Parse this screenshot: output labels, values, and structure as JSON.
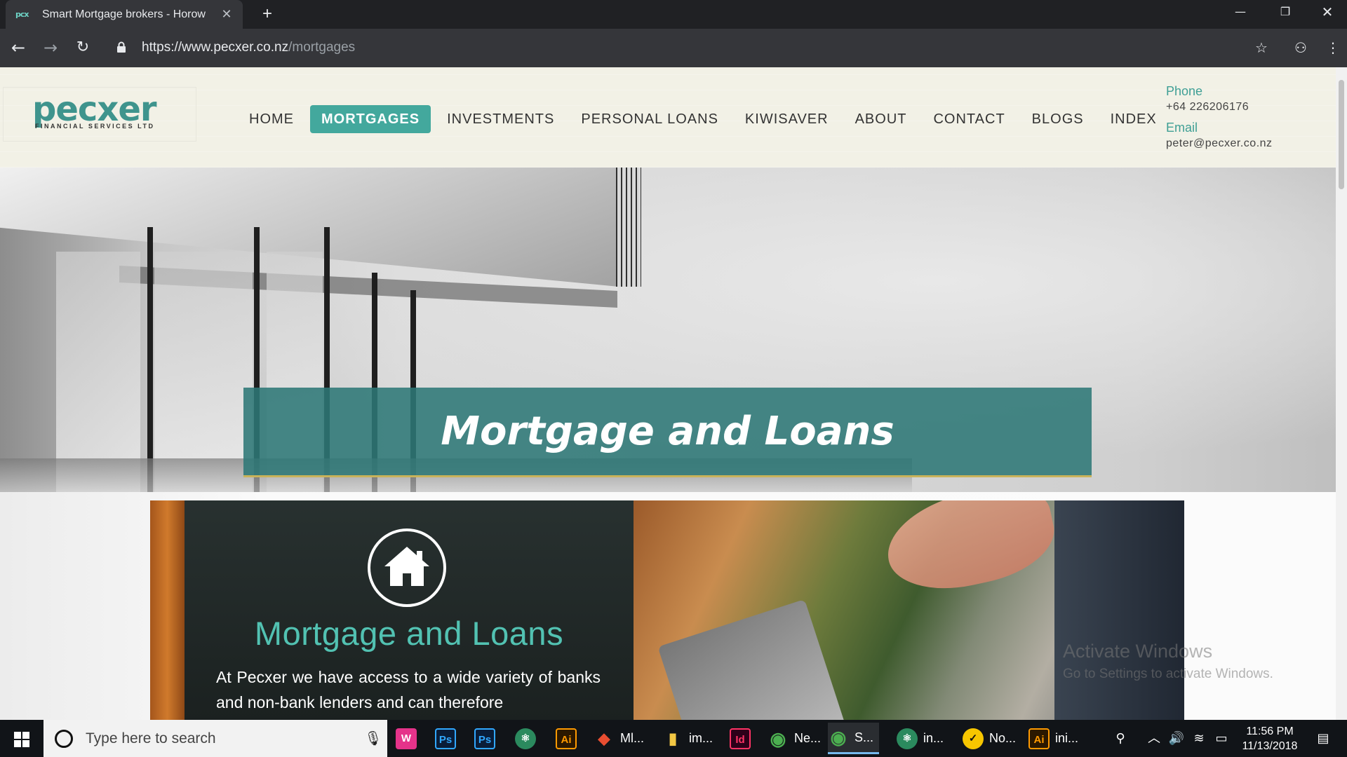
{
  "browser": {
    "tab_title": "Smart Mortgage brokers - Horow",
    "tab_favicon": "pcx",
    "new_tab_symbol": "+",
    "url_host": "https://www.pecxer.co.nz",
    "url_path": "/mortgages"
  },
  "site": {
    "logo_text": "pecxer",
    "logo_subtext": "FINANCIAL SERVICES LTD",
    "nav": [
      {
        "label": "HOME"
      },
      {
        "label": "MORTGAGES",
        "active": true
      },
      {
        "label": "INVESTMENTS"
      },
      {
        "label": "PERSONAL LOANS"
      },
      {
        "label": "KIWISAVER"
      },
      {
        "label": "ABOUT"
      },
      {
        "label": "CONTACT"
      },
      {
        "label": "BLOGS"
      },
      {
        "label": "INDEX"
      }
    ],
    "contact": {
      "phone_label": "Phone",
      "phone": "+64 226206176",
      "email_label": "Email",
      "email": "peter@pecxer.co.nz"
    },
    "hero_title": "Mortgage and Loans",
    "section": {
      "title": "Mortgage and Loans",
      "text": "At Pecxer we have access to a wide variety of banks and non-bank lenders and can therefore"
    },
    "colors": {
      "accent": "#43a89d",
      "banner": "#2e7876",
      "panel_title": "#52c2b2"
    }
  },
  "watermark": {
    "line1": "Activate Windows",
    "line2": "Go to Settings to activate Windows."
  },
  "taskbar": {
    "search_placeholder": "Type here to search",
    "apps": [
      {
        "icon": "webstorm-icon",
        "glyph": "W",
        "label": ""
      },
      {
        "icon": "photoshop-icon",
        "glyph": "Ps",
        "label": ""
      },
      {
        "icon": "photoshop-icon-2",
        "glyph": "Ps",
        "label": ""
      },
      {
        "icon": "atom-icon",
        "glyph": "⚛",
        "label": ""
      },
      {
        "icon": "illustrator-icon",
        "glyph": "Ai",
        "label": ""
      },
      {
        "icon": "git-icon",
        "glyph": "◆",
        "label": "Ml..."
      },
      {
        "icon": "folder-icon",
        "glyph": "▮",
        "label": "im..."
      },
      {
        "icon": "indesign-icon",
        "glyph": "Id",
        "label": ""
      },
      {
        "icon": "chrome-icon",
        "glyph": "◉",
        "label": "Ne..."
      },
      {
        "icon": "chrome-icon-2",
        "glyph": "◉",
        "label": "S..."
      },
      {
        "icon": "atom-icon-2",
        "glyph": "⚛",
        "label": "in..."
      },
      {
        "icon": "norton-icon",
        "glyph": "✓",
        "label": "No..."
      },
      {
        "icon": "illustrator-icon-2",
        "glyph": "Ai",
        "label": "ini..."
      }
    ],
    "time": "11:56 PM",
    "date": "11/13/2018"
  }
}
